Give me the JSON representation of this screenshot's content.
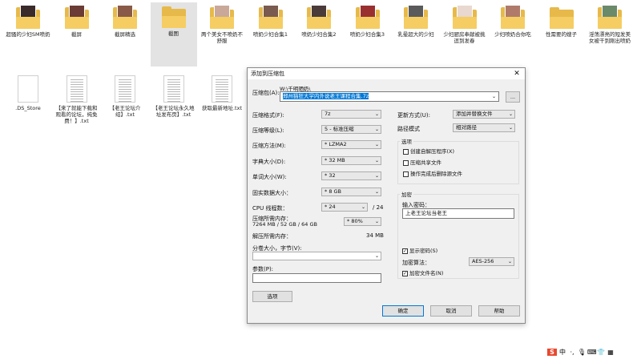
{
  "desktop": {
    "row1": [
      {
        "label": "超骚的少妇SM喷奶",
        "photo": "#3a2a2a"
      },
      {
        "label": "截屏",
        "photo": "#6b3b35"
      },
      {
        "label": "截屏精选",
        "photo": "#8a5a48"
      },
      {
        "label": "截图",
        "photo": ""
      },
      {
        "label": "两个美女不喷奶不舒服",
        "photo": "#c9a89a"
      },
      {
        "label": "喷奶少妇合集1",
        "photo": "#7a5b4f"
      },
      {
        "label": "喷奶少妇合集2",
        "photo": "#4a3a3a"
      },
      {
        "label": "喷奶少妇合集3",
        "photo": "#9a2f2f"
      },
      {
        "label": "乳晕超大的少妇",
        "photo": "#5a5a5a"
      },
      {
        "label": "少妇厨房奉献被挑逗到发春",
        "photo": "#e8d8d0"
      },
      {
        "label": "少妇喷奶合你吃",
        "photo": "#b07a6a"
      },
      {
        "label": "性需要的嫂子",
        "photo": ""
      },
      {
        "label": "淫荡漂亮的短发美女被干到刚出喷奶",
        "photo": "#6a8a6a"
      }
    ],
    "row2": [
      {
        "label": ".DS_Store"
      },
      {
        "label": "【来了就能下载和观看的论坛，纯免费！】.txt"
      },
      {
        "label": "【老王论坛介绍】.txt"
      },
      {
        "label": "【老王论坛永久地址发布页】.txt"
      },
      {
        "label": "获取最新地址.txt"
      }
    ]
  },
  "dialog": {
    "title": "添加到压缩包",
    "close": "✕",
    "archive_label": "压缩包(A):",
    "archive_path_dir": "W:\\千明晒奶\\",
    "archive_name": "郑州猫狂大学内外说老王课程合集.7z",
    "browse": "...",
    "format_label": "压缩格式(F):",
    "format_value": "7z",
    "level_label": "压缩等级(L):",
    "level_value": "5 - 标准压缩",
    "method_label": "压缩方法(M):",
    "method_value": "* LZMA2",
    "dict_label": "字典大小(D):",
    "dict_value": "* 32 MB",
    "word_label": "单词大小(W):",
    "word_value": "* 32",
    "solid_label": "固实数据大小：",
    "solid_value": "* 8 GB",
    "cpu_label": "CPU 线程数：",
    "cpu_value": "* 24",
    "cpu_total": "/ 24",
    "mem_label": "压缩所需内存：",
    "mem_detail": "7264 MB / 52 GB / 64 GB",
    "mem_percent": "* 80%",
    "decomp_label": "解压所需内存：",
    "decomp_value": "34 MB",
    "split_label": "分卷大小，字节(V):",
    "params_label": "参数(P):",
    "options_button": "选项",
    "update_label": "更新方式(U):",
    "update_value": "添加并替换文件",
    "path_label": "路径模式",
    "path_value": "相对路径",
    "options_group": "选项",
    "opt1": "创建自解压程序(X)",
    "opt2": "压缩共享文件",
    "opt3": "操作完成后删除源文件",
    "encrypt_group": "加密",
    "password_label": "输入密码：",
    "password_value": "上老王论坛当老王",
    "show_password": "显示密码(S)",
    "enc_method_label": "加密算法：",
    "enc_method_value": "AES-256",
    "encrypt_names": "加密文件名(N)",
    "ok": "确定",
    "cancel": "取消",
    "help": "帮助"
  },
  "tray": {
    "ime": "中",
    "items": [
      "S",
      "中",
      "·,",
      "🎙",
      "⌨",
      "👕",
      "▦"
    ]
  }
}
